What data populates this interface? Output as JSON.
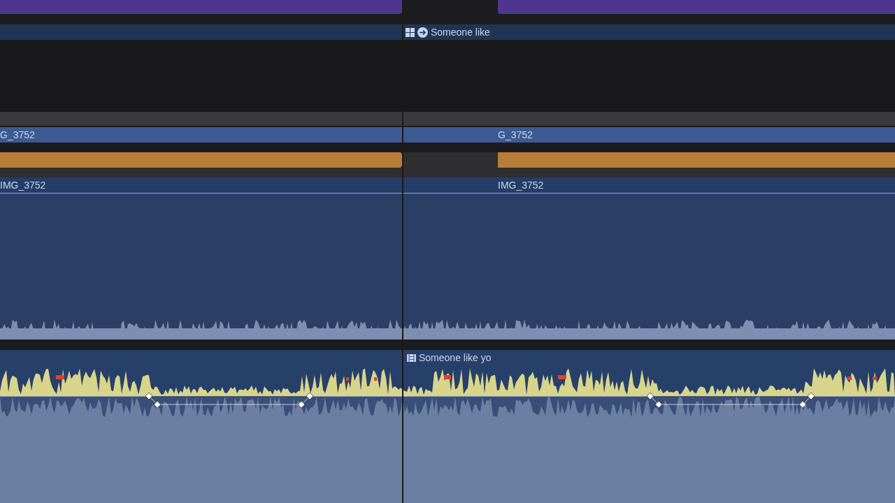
{
  "title_clip": {
    "label": "Someone like"
  },
  "video_clips": [
    {
      "label": "G_3752"
    },
    {
      "label": "G_3752"
    }
  ],
  "audio_clips": [
    {
      "label": "IMG_3752"
    },
    {
      "label": "IMG_3752"
    }
  ],
  "music_clip": {
    "label": "Someone like yo"
  }
}
